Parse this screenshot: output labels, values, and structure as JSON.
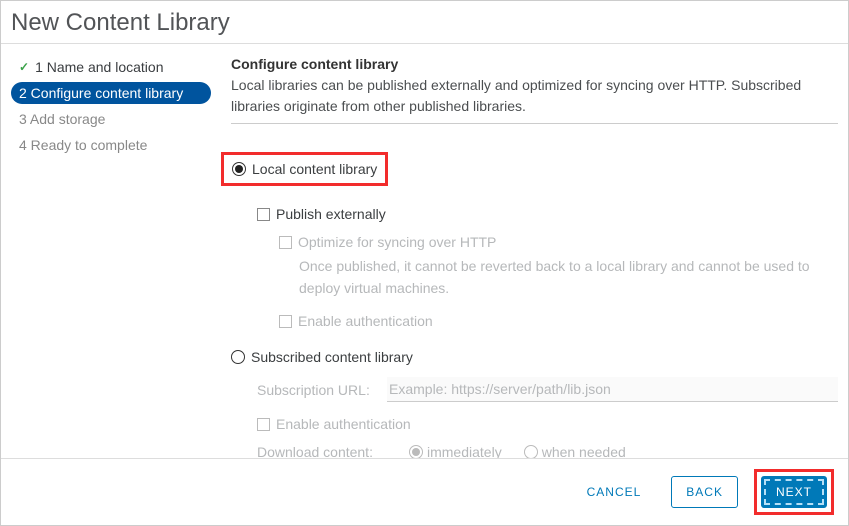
{
  "dialog": {
    "title": "New Content Library"
  },
  "steps": {
    "s1": "1 Name and location",
    "s2": "2 Configure content library",
    "s3": "3 Add storage",
    "s4": "4 Ready to complete"
  },
  "main": {
    "heading": "Configure content library",
    "desc": "Local libraries can be published externally and optimized for syncing over HTTP. Subscribed libraries originate from other published libraries.",
    "local_radio": "Local content library",
    "publish_ext": "Publish externally",
    "optimize": "Optimize for syncing over HTTP",
    "optimize_note": "Once published, it cannot be reverted back to a local library and cannot be used to deploy virtual machines.",
    "enable_auth": "Enable authentication",
    "subscribed_radio": "Subscribed content library",
    "sub_url_label": "Subscription URL:",
    "sub_url_placeholder": "Example: https://server/path/lib.json",
    "enable_auth2": "Enable authentication",
    "download_label": "Download content:",
    "download_imm": "immediately",
    "download_when": "when needed"
  },
  "footer": {
    "cancel": "Cancel",
    "back": "Back",
    "next": "Next"
  }
}
